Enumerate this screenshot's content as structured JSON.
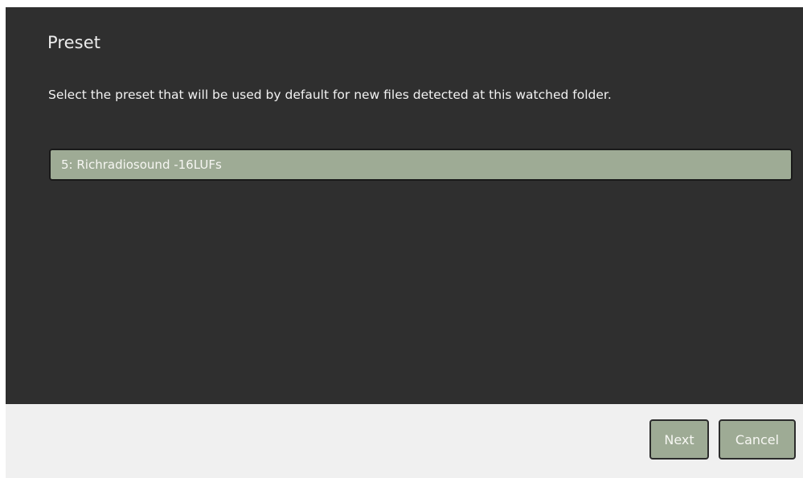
{
  "dialog": {
    "title": "Preset",
    "description": "Select the preset that will be used by default for new files detected at this watched folder.",
    "preset_select": {
      "selected_value": "5: Richradiosound -16LUFs"
    }
  },
  "footer": {
    "next_label": "Next",
    "cancel_label": "Cancel"
  },
  "colors": {
    "panel_background": "#2f2f2f",
    "accent_green": "#9eab95",
    "footer_background": "#f0f0f0"
  }
}
